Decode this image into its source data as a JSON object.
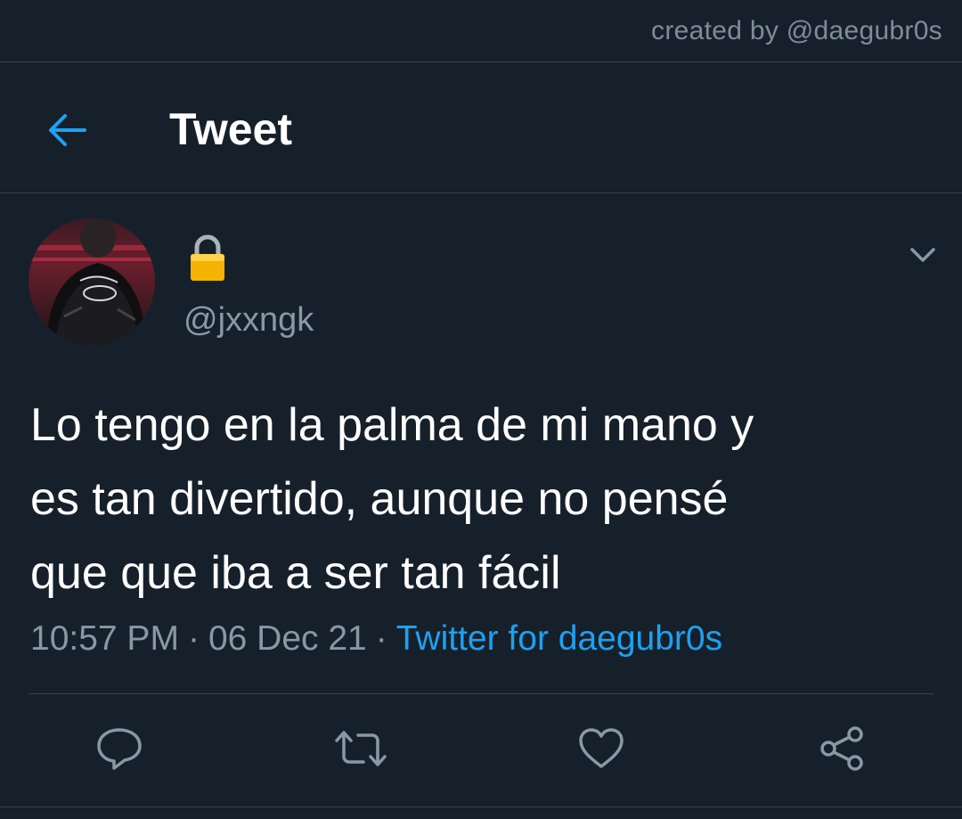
{
  "watermark": "created by @daegubr0s",
  "header": {
    "title": "Tweet",
    "back_icon": "arrow-left-icon"
  },
  "user": {
    "handle": "@jxxngk",
    "display_name_icon": "lock-icon",
    "avatar_icon": "avatar"
  },
  "tweet": {
    "lines": [
      "Lo tengo en la palma de mi mano y",
      "es tan divertido, aunque no pensé",
      "que que iba a ser tan fácil"
    ],
    "time": "10:57 PM",
    "date": "06 Dec 21",
    "separator": "·",
    "client": "Twitter for daegubr0s"
  },
  "actions": [
    "reply-icon",
    "retweet-icon",
    "like-icon",
    "share-icon"
  ],
  "colors": {
    "background": "#16202b",
    "accent": "#1da1f2",
    "secondary_text": "#8899a6",
    "divider": "#38444d"
  }
}
